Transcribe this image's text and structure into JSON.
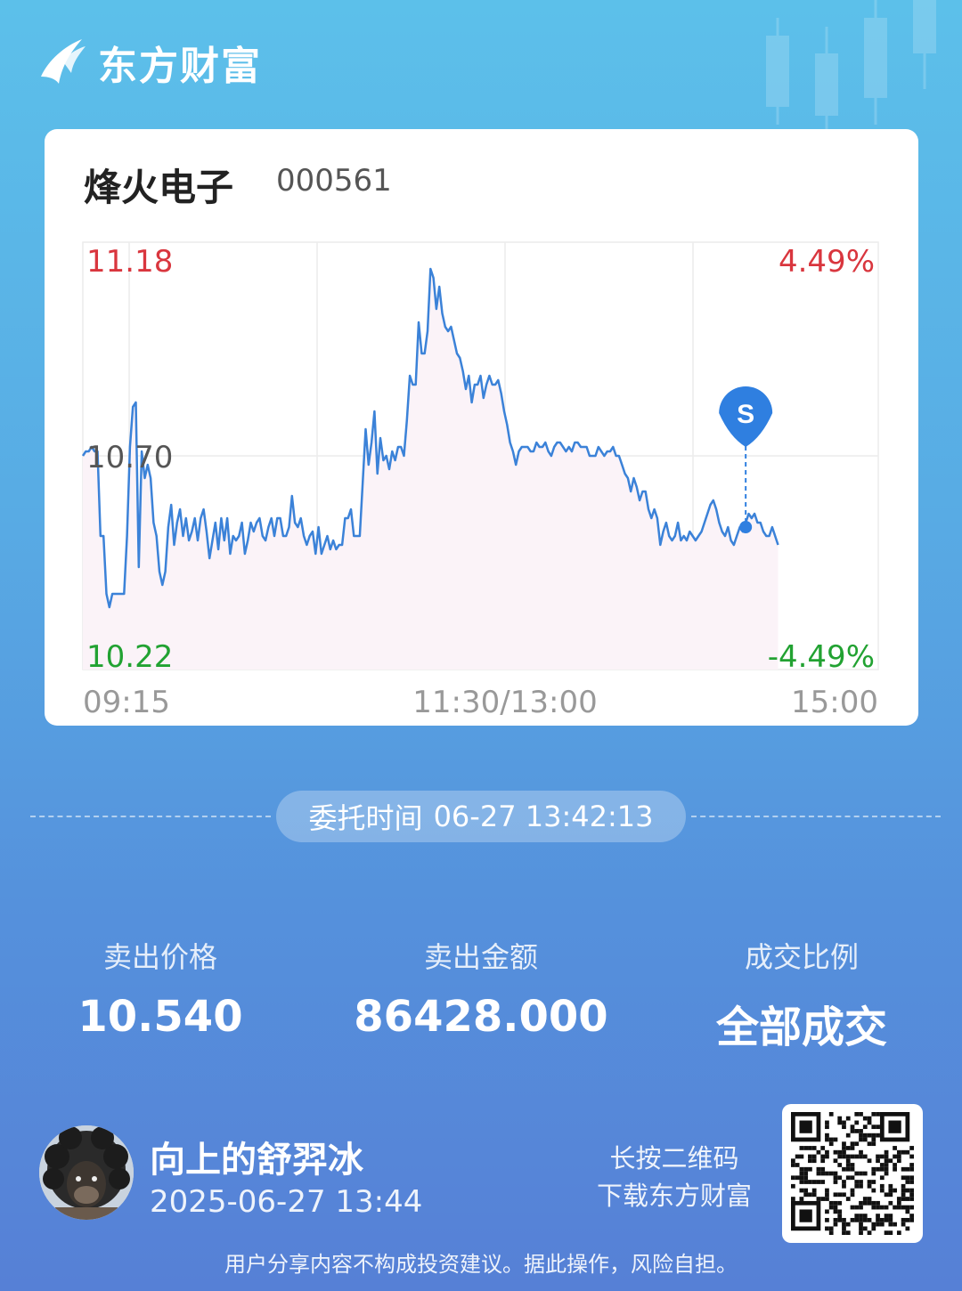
{
  "brand": {
    "name": "东方财富"
  },
  "stock": {
    "name": "烽火电子",
    "code": "000561"
  },
  "chart_data": {
    "type": "line",
    "title": "",
    "ylabel": "",
    "y_left_ticks": {
      "top": "11.18",
      "mid": "10.70",
      "bottom": "10.22"
    },
    "y_right_ticks": {
      "top": "4.49%",
      "bottom": "-4.49%"
    },
    "x_tick_labels": {
      "left": "09:15",
      "mid": "11:30/13:00",
      "right": "15:00"
    },
    "ylim": [
      10.22,
      11.18
    ],
    "prev_close": 10.7,
    "colors": {
      "up": "#d9363e",
      "down": "#22a232",
      "line": "#3b82d8",
      "fill": "#fbf3f8",
      "marker": "#2f7fe0"
    },
    "series": [
      {
        "values": [
          10.7,
          10.71,
          10.71,
          10.72,
          10.71,
          10.71,
          10.52,
          10.52,
          10.39,
          10.36,
          10.39,
          10.39,
          10.39,
          10.39,
          10.39,
          10.52,
          10.72,
          10.81,
          10.82,
          10.45,
          10.71,
          10.65,
          10.68,
          10.65,
          10.55,
          10.52,
          10.44,
          10.41,
          10.44,
          10.54,
          10.59,
          10.5,
          10.55,
          10.58,
          10.52,
          10.56,
          10.51,
          10.53,
          10.56,
          10.51,
          10.56,
          10.58,
          10.53,
          10.47,
          10.51,
          10.55,
          10.49,
          10.56,
          10.51,
          10.56,
          10.48,
          10.52,
          10.51,
          10.52,
          10.55,
          10.48,
          10.51,
          10.55,
          10.53,
          10.55,
          10.56,
          10.52,
          10.51,
          10.54,
          10.56,
          10.52,
          10.56,
          10.56,
          10.52,
          10.52,
          10.54,
          10.61,
          10.55,
          10.54,
          10.56,
          10.52,
          10.5,
          10.52,
          10.53,
          10.48,
          10.54,
          10.48,
          10.5,
          10.52,
          10.49,
          10.51,
          10.49,
          10.5,
          10.5,
          10.56,
          10.56,
          10.58,
          10.52,
          10.52,
          10.52,
          10.64,
          10.76,
          10.68,
          10.73,
          10.8,
          10.66,
          10.74,
          10.69,
          10.7,
          10.67,
          10.71,
          10.69,
          10.72,
          10.72,
          10.7,
          10.78,
          10.88,
          10.86,
          10.86,
          11.0,
          10.93,
          10.93,
          10.98,
          11.12,
          11.1,
          11.03,
          11.08,
          11.02,
          10.99,
          10.98,
          10.99,
          10.96,
          10.93,
          10.92,
          10.89,
          10.85,
          10.88,
          10.82,
          10.86,
          10.86,
          10.88,
          10.83,
          10.86,
          10.88,
          10.86,
          10.86,
          10.87,
          10.84,
          10.8,
          10.77,
          10.73,
          10.71,
          10.68,
          10.71,
          10.72,
          10.72,
          10.72,
          10.71,
          10.71,
          10.73,
          10.72,
          10.72,
          10.73,
          10.71,
          10.7,
          10.72,
          10.73,
          10.73,
          10.72,
          10.71,
          10.72,
          10.71,
          10.73,
          10.73,
          10.72,
          10.72,
          10.72,
          10.7,
          10.7,
          10.7,
          10.72,
          10.71,
          10.7,
          10.71,
          10.71,
          10.72,
          10.7,
          10.7,
          10.68,
          10.66,
          10.65,
          10.62,
          10.65,
          10.63,
          10.6,
          10.62,
          10.62,
          10.58,
          10.56,
          10.58,
          10.56,
          10.5,
          10.53,
          10.55,
          10.52,
          10.51,
          10.52,
          10.55,
          10.51,
          10.52,
          10.51,
          10.53,
          10.52,
          10.51,
          10.52,
          10.53,
          10.55,
          10.57,
          10.59,
          10.6,
          10.58,
          10.55,
          10.53,
          10.52,
          10.54,
          10.51,
          10.5,
          10.52,
          10.54,
          10.53,
          10.55,
          10.57,
          10.56,
          10.57,
          10.55,
          10.55,
          10.53,
          10.52,
          10.52,
          10.54,
          10.52,
          10.5
        ]
      }
    ],
    "trade_marker": {
      "label": "S",
      "index": 225,
      "price": 10.54
    }
  },
  "order_time": {
    "label": "委托时间",
    "value": "06-27 13:42:13"
  },
  "metrics": [
    {
      "label": "卖出价格",
      "value": "10.540"
    },
    {
      "label": "卖出金额",
      "value": "86428.000"
    },
    {
      "label": "成交比例",
      "value": "全部成交"
    }
  ],
  "user": {
    "name": "向上的舒羿冰",
    "time": "2025-06-27 13:44"
  },
  "qr_hint": {
    "line1": "长按二维码",
    "line2": "下载东方财富"
  },
  "disclaimer": "用户分享内容不构成投资建议。据此操作，风险自担。"
}
